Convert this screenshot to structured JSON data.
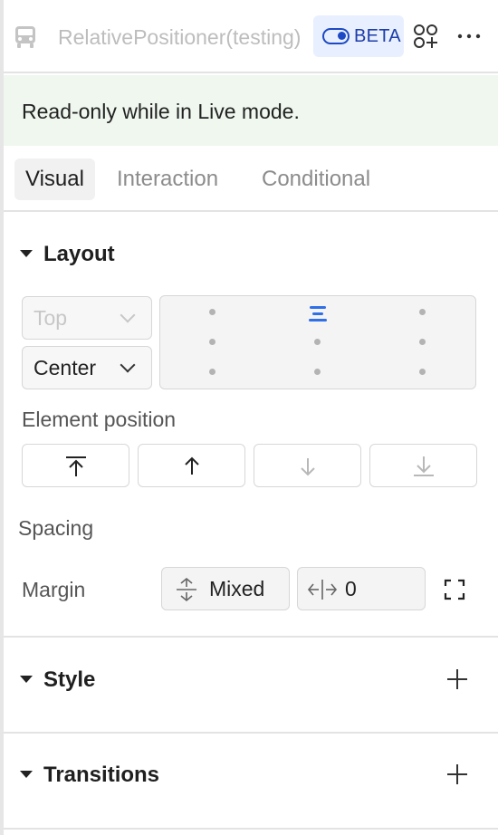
{
  "header": {
    "title": "RelativePositioner(testing)",
    "component_icon": "bus-icon",
    "beta_label": "BETA",
    "add_icon": "add-component-icon",
    "more_icon": "more-icon"
  },
  "banner": {
    "text": "Read-only while in Live mode."
  },
  "tabs": [
    {
      "label": "Visual",
      "active": true
    },
    {
      "label": "Interaction",
      "active": false
    },
    {
      "label": "Conditional",
      "active": false
    }
  ],
  "layout": {
    "title": "Layout",
    "vertical_select": {
      "value": "Top",
      "disabled": true
    },
    "horizontal_select": {
      "value": "Center",
      "disabled": false
    },
    "element_position_label": "Element position",
    "position_buttons": [
      "move-to-top-icon",
      "move-up-icon",
      "move-down-icon",
      "move-to-bottom-icon"
    ],
    "spacing_label": "Spacing",
    "margin": {
      "label": "Margin",
      "vertical_value": "Mixed",
      "horizontal_value": "0"
    }
  },
  "style": {
    "title": "Style"
  },
  "transitions": {
    "title": "Transitions"
  },
  "colors": {
    "accent": "#1d49c4",
    "banner_bg": "#eff7ef",
    "beta_bg": "#e8efff"
  }
}
